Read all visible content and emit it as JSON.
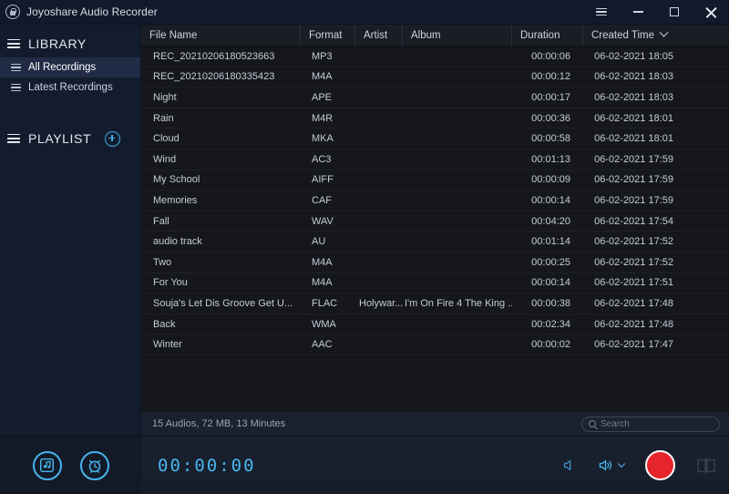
{
  "window": {
    "title": "Joyoshare Audio Recorder",
    "logo_icon": "lock-recorder-icon",
    "controls": [
      {
        "name": "menu-button",
        "icon": "hamburger-menu-icon"
      },
      {
        "name": "minimize-button",
        "icon": "minimize-icon"
      },
      {
        "name": "maximize-button",
        "icon": "maximize-icon"
      },
      {
        "name": "close-button",
        "icon": "close-icon"
      }
    ]
  },
  "sidebar": {
    "library": {
      "label": "LIBRARY",
      "icon": "list-lines-icon",
      "items": [
        {
          "label": "All Recordings",
          "icon": "list-lines-icon",
          "selected": true
        },
        {
          "label": "Latest Recordings",
          "icon": "list-lines-icon",
          "selected": false
        }
      ]
    },
    "playlist": {
      "label": "PLAYLIST",
      "icon": "list-lines-icon",
      "add_icon": "plus-circle-icon"
    }
  },
  "table": {
    "columns": [
      {
        "key": "name",
        "label": "File Name",
        "sorted": false
      },
      {
        "key": "format",
        "label": "Format",
        "sorted": false
      },
      {
        "key": "artist",
        "label": "Artist",
        "sorted": false
      },
      {
        "key": "album",
        "label": "Album",
        "sorted": false
      },
      {
        "key": "dur",
        "label": "Duration",
        "sorted": false
      },
      {
        "key": "time",
        "label": "Created Time",
        "sorted": true,
        "sort_icon": "chevron-down-icon"
      }
    ],
    "rows": [
      {
        "name": "REC_20210206180523663",
        "format": "MP3",
        "artist": "",
        "album": "",
        "dur": "00:00:06",
        "time": "06-02-2021 18:05"
      },
      {
        "name": "REC_20210206180335423",
        "format": "M4A",
        "artist": "",
        "album": "",
        "dur": "00:00:12",
        "time": "06-02-2021 18:03"
      },
      {
        "name": "Night",
        "format": "APE",
        "artist": "",
        "album": "",
        "dur": "00:00:17",
        "time": "06-02-2021 18:03"
      },
      {
        "name": "Rain",
        "format": "M4R",
        "artist": "",
        "album": "",
        "dur": "00:00:36",
        "time": "06-02-2021 18:01"
      },
      {
        "name": "Cloud",
        "format": "MKA",
        "artist": "",
        "album": "",
        "dur": "00:00:58",
        "time": "06-02-2021 18:01"
      },
      {
        "name": "Wind",
        "format": "AC3",
        "artist": "",
        "album": "",
        "dur": "00:01:13",
        "time": "06-02-2021 17:59"
      },
      {
        "name": "My School",
        "format": "AIFF",
        "artist": "",
        "album": "",
        "dur": "00:00:09",
        "time": "06-02-2021 17:59"
      },
      {
        "name": "Memories",
        "format": "CAF",
        "artist": "",
        "album": "",
        "dur": "00:00:14",
        "time": "06-02-2021 17:59"
      },
      {
        "name": "Fall",
        "format": "WAV",
        "artist": "",
        "album": "",
        "dur": "00:04:20",
        "time": "06-02-2021 17:54"
      },
      {
        "name": "audio track",
        "format": "AU",
        "artist": "",
        "album": "",
        "dur": "00:01:14",
        "time": "06-02-2021 17:52"
      },
      {
        "name": "Two",
        "format": "M4A",
        "artist": "",
        "album": "",
        "dur": "00:00:25",
        "time": "06-02-2021 17:52"
      },
      {
        "name": "For You",
        "format": "M4A",
        "artist": "",
        "album": "",
        "dur": "00:00:14",
        "time": "06-02-2021 17:51"
      },
      {
        "name": "Souja's Let Dis Groove Get U...",
        "format": "FLAC",
        "artist": "Holywar...",
        "album": "I'm On Fire 4 The King ...",
        "dur": "00:00:38",
        "time": "06-02-2021 17:48"
      },
      {
        "name": "Back",
        "format": "WMA",
        "artist": "",
        "album": "",
        "dur": "00:02:34",
        "time": "06-02-2021 17:48"
      },
      {
        "name": "Winter",
        "format": "AAC",
        "artist": "",
        "album": "",
        "dur": "00:00:02",
        "time": "06-02-2021 17:47"
      }
    ]
  },
  "statusbar": {
    "summary": "15 Audios, 72 MB, 13 Minutes",
    "search": {
      "placeholder": "Search",
      "value": "",
      "icon": "search-icon"
    }
  },
  "player": {
    "library_button_icon": "music-note-list-icon",
    "scheduler_button_icon": "alarm-clock-icon",
    "timer": "00:00:00",
    "controls": [
      {
        "name": "system-sound-button",
        "icon": "speaker-mute-icon",
        "disabled": false
      },
      {
        "name": "microphone-volume-button",
        "icon": "speaker-waves-icon",
        "disabled": false
      },
      {
        "name": "record-button",
        "icon": "record-circle-icon",
        "disabled": false
      },
      {
        "name": "panel-toggle-button",
        "icon": "split-panel-icon",
        "disabled": true
      }
    ]
  },
  "colors": {
    "accent": "#49b6ee",
    "record": "#e6242b",
    "titlebar_bg": "#101a2b",
    "sidebar_bg": "#131c2d",
    "table_bg": "#15171c",
    "selection_bg": "#222b45"
  }
}
